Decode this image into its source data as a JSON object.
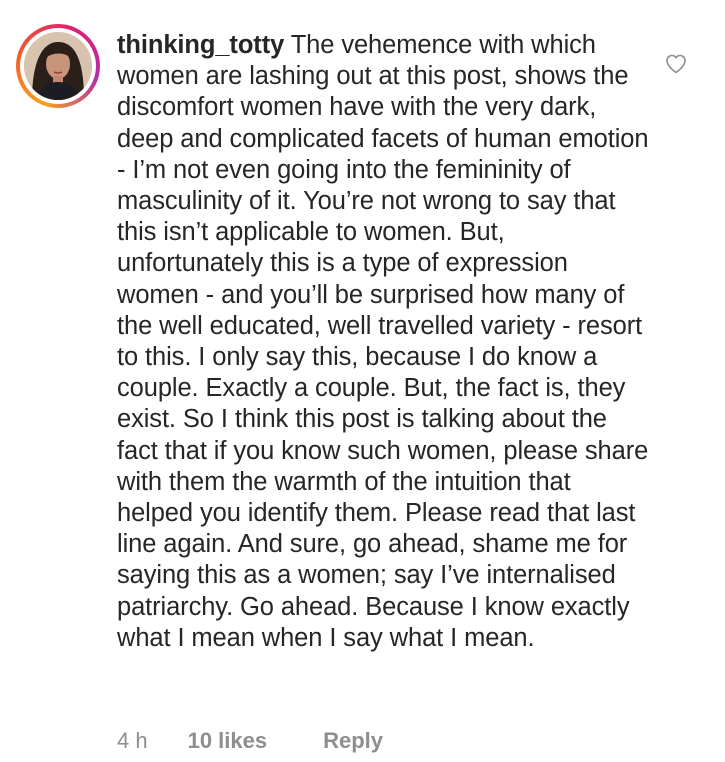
{
  "comment": {
    "username": "thinking_totty",
    "text": "The vehemence with which women are lashing out at this post, shows the discomfort women have with the very dark, deep and complicated facets of human emotion - I’m not even going into the femininity of masculinity of it. You’re not wrong to say that this isn’t applicable to women. But, unfortunately this is a type of expression women - and you’ll be surprised how many of the well educated, well travelled variety - resort to this. I only say this, because I do know a couple. Exactly a couple. But, the fact is, they exist. So I think this post is talking about the fact that if you know such women, please share with them the warmth of the intuition that helped you identify them. Please read that last line again. And sure, go ahead, shame me for saying this as a women; say I’ve internalised patriarchy. Go ahead. Because I know exactly what I mean when I say what I mean.",
    "time": "4 h",
    "likes": "10 likes",
    "reply_label": "Reply",
    "like_icon": "heart-outline-icon",
    "colors": {
      "text": "#262626",
      "meta": "#8e8e8e",
      "story_ring": [
        "#f9a21a",
        "#f35a2b",
        "#e01d73",
        "#b530a8"
      ]
    }
  }
}
